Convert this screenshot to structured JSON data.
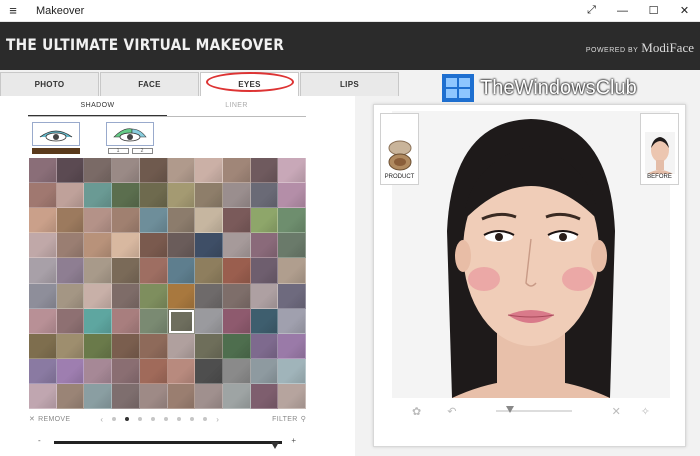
{
  "window": {
    "title": "Makeover",
    "controls": [
      "expand-icon",
      "minimize-icon",
      "maximize-icon",
      "close-icon"
    ]
  },
  "banner": {
    "brand": "THE ULTIMATE VIRTUAL MAKEOVER",
    "powered_by": "POWERED BY",
    "powered_brand": "ModiFace"
  },
  "tabs": [
    {
      "label": "PHOTO",
      "active": false
    },
    {
      "label": "FACE",
      "active": false
    },
    {
      "label": "EYES",
      "active": true
    },
    {
      "label": "LIPS",
      "active": false
    }
  ],
  "subtabs": [
    {
      "label": "SHADOW",
      "active": true
    },
    {
      "label": "LINER",
      "active": false
    }
  ],
  "patterns": {
    "first_swatch_color": "#5a3a1c",
    "second_swatch_numbers": [
      "1",
      "2"
    ]
  },
  "palette": {
    "selected_index": 65,
    "colors": [
      "#8a6e78",
      "#5b4a52",
      "#7a6a66",
      "#9a8a86",
      "#6f5a4e",
      "#b09a8c",
      "#cbb0a6",
      "#a08678",
      "#6f5a5e",
      "#c8a8b8",
      "#a07870",
      "#bfa19a",
      "#6a9a94",
      "#5b6e4e",
      "#6e6a4e",
      "#a49a72",
      "#8e7e6a",
      "#9a8e8e",
      "#6a6a76",
      "#b48ea8",
      "#caa08a",
      "#9c7a5e",
      "#b49288",
      "#a08070",
      "#6e8e9a",
      "#8c7c6c",
      "#c6b6a0",
      "#7a5a5a",
      "#8ea66a",
      "#6e8e6e",
      "#c0a8a8",
      "#9a7e72",
      "#b8927a",
      "#d8b8a0",
      "#7a5a4e",
      "#6a5c5a",
      "#3e4e66",
      "#a69a9a",
      "#8a6a7a",
      "#6a7a6a",
      "#a8a0a8",
      "#8e7e92",
      "#a89a8a",
      "#7a6a58",
      "#9e6e62",
      "#5e7e8e",
      "#8e7e5e",
      "#9a5e4e",
      "#6e5e6e",
      "#b09e8e",
      "#8e8e9a",
      "#a49684",
      "#c8b0a8",
      "#7e6c68",
      "#7e8e5e",
      "#a8783e",
      "#6e6a6a",
      "#7e6e6a",
      "#aea0a2",
      "#6e6a7e",
      "#b89096",
      "#8e7072",
      "#5ea6a0",
      "#a87e7e",
      "#7a8a72",
      "#6e6e5e",
      "#9a9a9e",
      "#8e5a6e",
      "#3e5e6e",
      "#a0a0ae",
      "#7e6e4e",
      "#9e8e6e",
      "#6a7a4a",
      "#7a5e4e",
      "#8e6a5a",
      "#b0a09e",
      "#6e6e5a",
      "#4e6e4e",
      "#7e6a8e",
      "#9a7aa8",
      "#8a7aa2",
      "#9e7eb0",
      "#a68896",
      "#8a6e72",
      "#a06a5a",
      "#b88a7e",
      "#4e4e4e",
      "#8a8a8a",
      "#8e9aa0",
      "#a0b4ba",
      "#c0a6b0",
      "#9a8476",
      "#8a9ea2",
      "#7e6e6e",
      "#9e8a86",
      "#9a7e70",
      "#a0908e",
      "#9ea4a4",
      "#7e5e6e",
      "#b6a49e"
    ]
  },
  "grid_footer": {
    "remove_label": "REMOVE",
    "filter_label": "FILTER",
    "page_count": 8,
    "current_page": 2
  },
  "intensity_slider": {
    "minus": "-",
    "plus": "+",
    "value_fraction": 0.97
  },
  "preview": {
    "product_label": "PRODUCT",
    "before_label": "BEFORE",
    "toolbar_icons": [
      "settings-icon",
      "undo-icon",
      "zoom-slider",
      "close-icon",
      "compare-icon"
    ]
  },
  "watermark": {
    "text": "TheWindowsClub"
  }
}
